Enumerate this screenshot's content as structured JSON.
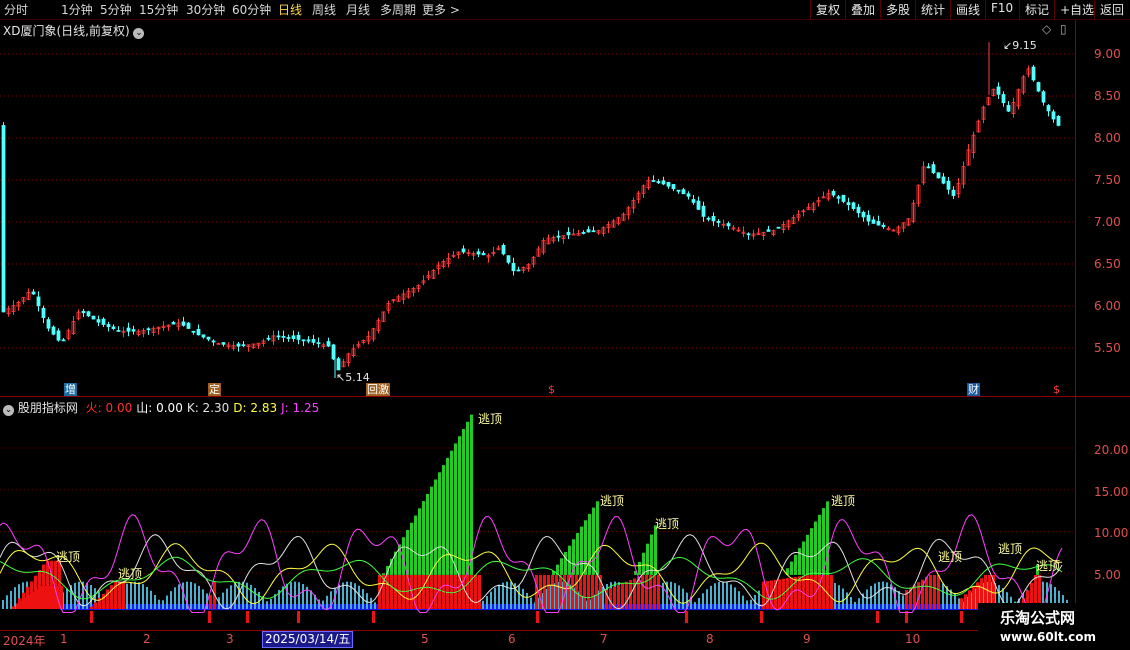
{
  "toolbar": {
    "periods": [
      "分时",
      "1分钟",
      "5分钟",
      "15分钟",
      "30分钟",
      "60分钟",
      "日线",
      "周线",
      "月线",
      "多周期",
      "更多 >"
    ],
    "active_period": "日线",
    "right_buttons": [
      "复权",
      "叠加",
      "多股",
      "统计",
      "画线",
      "F10",
      "标记",
      "+自选",
      "返回"
    ]
  },
  "main": {
    "title": "XD厦门象(日线,前复权)",
    "y_ticks": [
      "9.00",
      "8.50",
      "8.00",
      "7.50",
      "7.00",
      "6.50",
      "6.00",
      "5.50"
    ],
    "high_label": "9.15",
    "low_label": "5.14",
    "events": [
      "增",
      "定",
      "回激",
      "$",
      "财",
      "$"
    ]
  },
  "indicator": {
    "name": "股朋指标网",
    "values": [
      {
        "label": "火:",
        "value": "0.00",
        "color": "#ff3030"
      },
      {
        "label": "山:",
        "value": "0.00",
        "color": "#ffffff"
      },
      {
        "label": "K:",
        "value": "2.30",
        "color": "#e0e0e0"
      },
      {
        "label": "D:",
        "value": "2.83",
        "color": "#ffff40"
      },
      {
        "label": "J:",
        "value": "1.25",
        "color": "#ff40ff"
      }
    ],
    "y_ticks": [
      "20.00",
      "15.00",
      "10.00",
      "5.00"
    ],
    "signal_labels": [
      "逃顶",
      "逃顶",
      "逃顶",
      "逃顶",
      "逃顶",
      "逃顶",
      "逃顶",
      "逃顶",
      "逃顶"
    ]
  },
  "timeline": {
    "year": "2024年",
    "months": [
      "1",
      "2",
      "3",
      "5",
      "6",
      "7",
      "8",
      "9",
      "10"
    ],
    "cursor_date": "2025/03/14/五"
  },
  "watermark": {
    "title": "乐淘公式网",
    "url": "www.60lt.com"
  },
  "colors": {
    "up": "#ff3c3c",
    "down": "#54ffff",
    "background": "#000000",
    "axis": "#8a0000",
    "green_bar": "#22cc22",
    "red_bar": "#ee1111"
  }
}
